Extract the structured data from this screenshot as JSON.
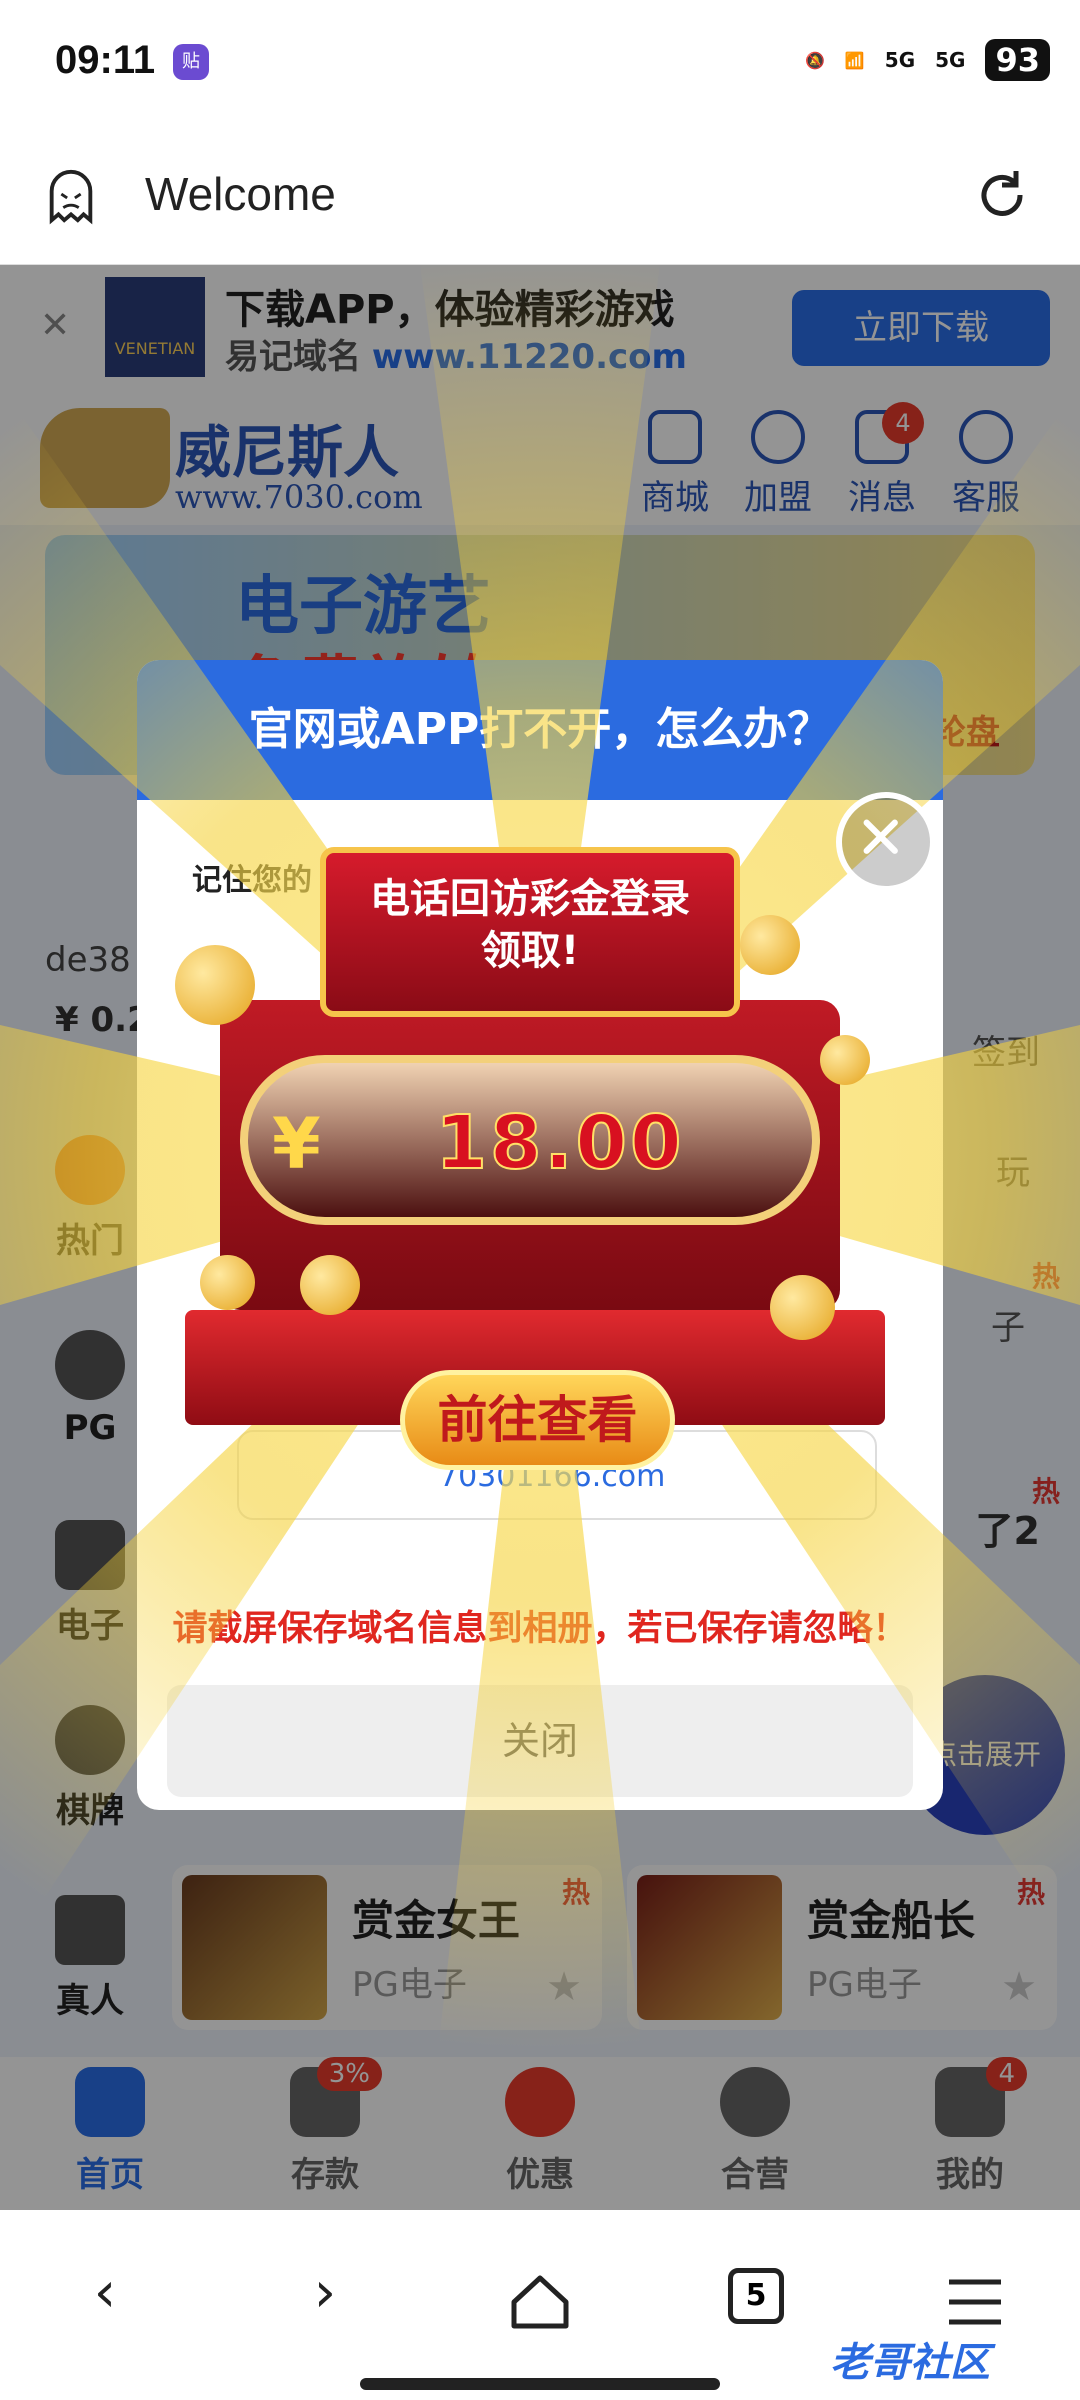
{
  "status": {
    "time": "09:11",
    "app_icon": "贴",
    "signal1": "5G",
    "signal2": "5G",
    "battery": "93"
  },
  "browser_top": {
    "title": "Welcome"
  },
  "banner": {
    "title": "下载APP，体验精彩游戏",
    "subtitle_prefix": "易记域名",
    "subtitle_url": "www.11220.com",
    "download": "立即下载",
    "logo_text": "VENETIAN"
  },
  "header": {
    "brand": "威尼斯人",
    "url": "www.7030.com",
    "nav": [
      {
        "label": "商城"
      },
      {
        "label": "加盟"
      },
      {
        "label": "消息",
        "badge": "4"
      },
      {
        "label": "客服"
      }
    ]
  },
  "promo": {
    "title": "电子游艺",
    "title2": "免费旋转",
    "wheel": "轮盘"
  },
  "left_content": {
    "user": "de38",
    "balance": "¥ 0.2",
    "checkin": "签到",
    "play": "玩"
  },
  "side_nav": [
    {
      "label": "热门"
    },
    {
      "label": "PG"
    },
    {
      "label": "电子"
    },
    {
      "label": "棋牌"
    },
    {
      "label": "真人"
    }
  ],
  "cards": [
    {
      "name": "赏金女王",
      "sub": "PG电子",
      "hot": "热"
    },
    {
      "name": "赏金船长",
      "sub": "PG电子",
      "hot": "热"
    }
  ],
  "right_labels": {
    "hot1": "热",
    "hot2": "热",
    "zi": "子",
    "le": "了2",
    "expand": "点击展开"
  },
  "bottom_nav": [
    {
      "label": "首页"
    },
    {
      "label": "存款",
      "badge": "3%"
    },
    {
      "label": "优惠"
    },
    {
      "label": "合营"
    },
    {
      "label": "我的",
      "badge": "4"
    }
  ],
  "dialog": {
    "title": "官网或APP打不开，怎么办？",
    "remember": "记住您的",
    "domain_text": "70301166.com",
    "warning": "请截屏保存域名信息到相册，若已保存请忽略！",
    "close": "关闭"
  },
  "prize": {
    "marquee": "电话回访彩金登录\n领取!",
    "currency": "¥",
    "amount": "18.00",
    "cta": "前往查看"
  },
  "browser_bottom": {
    "tabs": "5",
    "watermark": "老哥社区"
  }
}
